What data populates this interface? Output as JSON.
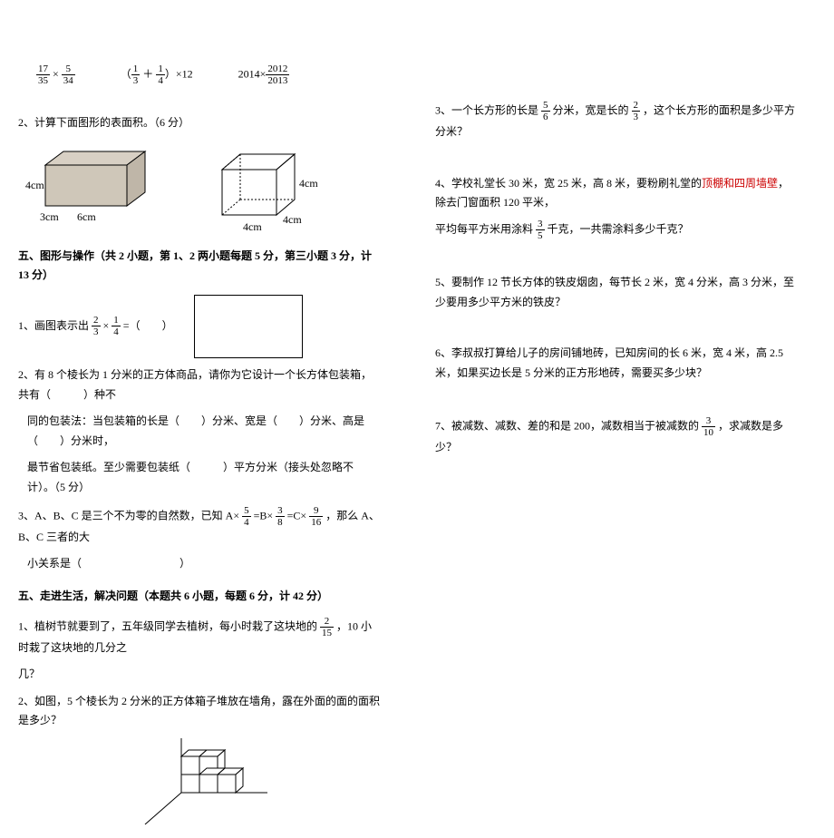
{
  "left": {
    "expr1": {
      "a_n": "17",
      "a_d": "35",
      "b_n": "5",
      "b_d": "34"
    },
    "expr2": {
      "a_n": "1",
      "a_d": "3",
      "b_n": "1",
      "b_d": "4",
      "tail": "）×12"
    },
    "expr3": {
      "lead": "2014×",
      "n": "2012",
      "d": "2013"
    },
    "q2_title": "2、计算下面图形的表面积。（6 分）",
    "cuboid1": {
      "h": "4cm",
      "d": "3cm",
      "w": "6cm"
    },
    "cuboid2": {
      "h": "4cm",
      "d": "4cm",
      "w": "4cm"
    },
    "sec5_title": "五、图形与操作（共 2 小题，第 1、2 两小题每题 5 分，第三小题 3 分，计 13 分）",
    "q5_1_lead": "1、画图表示出 ",
    "q5_1_an": "2",
    "q5_1_ad": "3",
    "q5_1_bn": "1",
    "q5_1_bd": "4",
    "q5_1_tail": " =（　　）",
    "q5_2a": "2、有 8 个棱长为 1 分米的正方体商品，请你为它设计一个长方体包装箱，共有（　　　）种不",
    "q5_2b": "同的包装法：当包装箱的长是（　　）分米、宽是（　　）分米、高是（　　）分米时，",
    "q5_2c": "最节省包装纸。至少需要包装纸（　　　）平方分米（接头处忽略不计）。（5 分）",
    "q5_3_lead": "3、A、B、C 是三个不为零的自然数，已知 A× ",
    "q5_3_an": "5",
    "q5_3_ad": "4",
    "q5_3_mid1": " =B× ",
    "q5_3_bn": "3",
    "q5_3_bd": "8",
    "q5_3_mid2": " =C× ",
    "q5_3_cn": "9",
    "q5_3_cd": "16",
    "q5_3_tail": " ，那么 A、B、C 三者的大",
    "q5_3_line2": "小关系是（　　　　　　　　　）",
    "sec_walk_title": "五、走进生活，解决问题（本题共 6 小题，每题 6 分，计 42 分）",
    "w1_lead": "1、植树节就要到了，五年级同学去植树，每小时栽了这块地的 ",
    "w1_n": "2",
    "w1_d": "15",
    "w1_tail": " ，10 小时栽了这块地的几分之",
    "w1_line2": "几？",
    "w2": "2、如图，5 个棱长为 2 分米的正方体箱子堆放在墙角，露在外面的面的面积是多少？"
  },
  "right": {
    "q3_lead": "3、一个长方形的长是 ",
    "q3_an": "5",
    "q3_ad": "6",
    "q3_mid": " 分米，宽是长的 ",
    "q3_bn": "2",
    "q3_bd": "3",
    "q3_tail": " ，这个长方形的面积是多少平方分米？",
    "q4_lead": "4、学校礼堂长 30 米，宽 25 米，高 8 米，要粉刷礼堂的",
    "q4_hl": "顶棚和四周墙壁",
    "q4_mid": "，除去门窗面积 120 平米，",
    "q4_line2_lead": "平均每平方米用涂料 ",
    "q4_n": "3",
    "q4_d": "5",
    "q4_line2_tail": " 千克，一共需涂料多少千克？",
    "q5": "5、要制作 12 节长方体的铁皮烟囱，每节长 2 米，宽 4 分米，高 3 分米，至少要用多少平方米的铁皮？",
    "q6": "6、李叔叔打算给儿子的房间铺地砖，已知房间的长 6 米，宽 4 米，高 2.5 米，如果买边长是 5 分米的正方形地砖，需要买多少块？",
    "q7_lead": "7、被减数、减数、差的和是 200，减数相当于被减数的 ",
    "q7_n": "3",
    "q7_d": "10",
    "q7_tail": " ，求减数是多少？"
  }
}
